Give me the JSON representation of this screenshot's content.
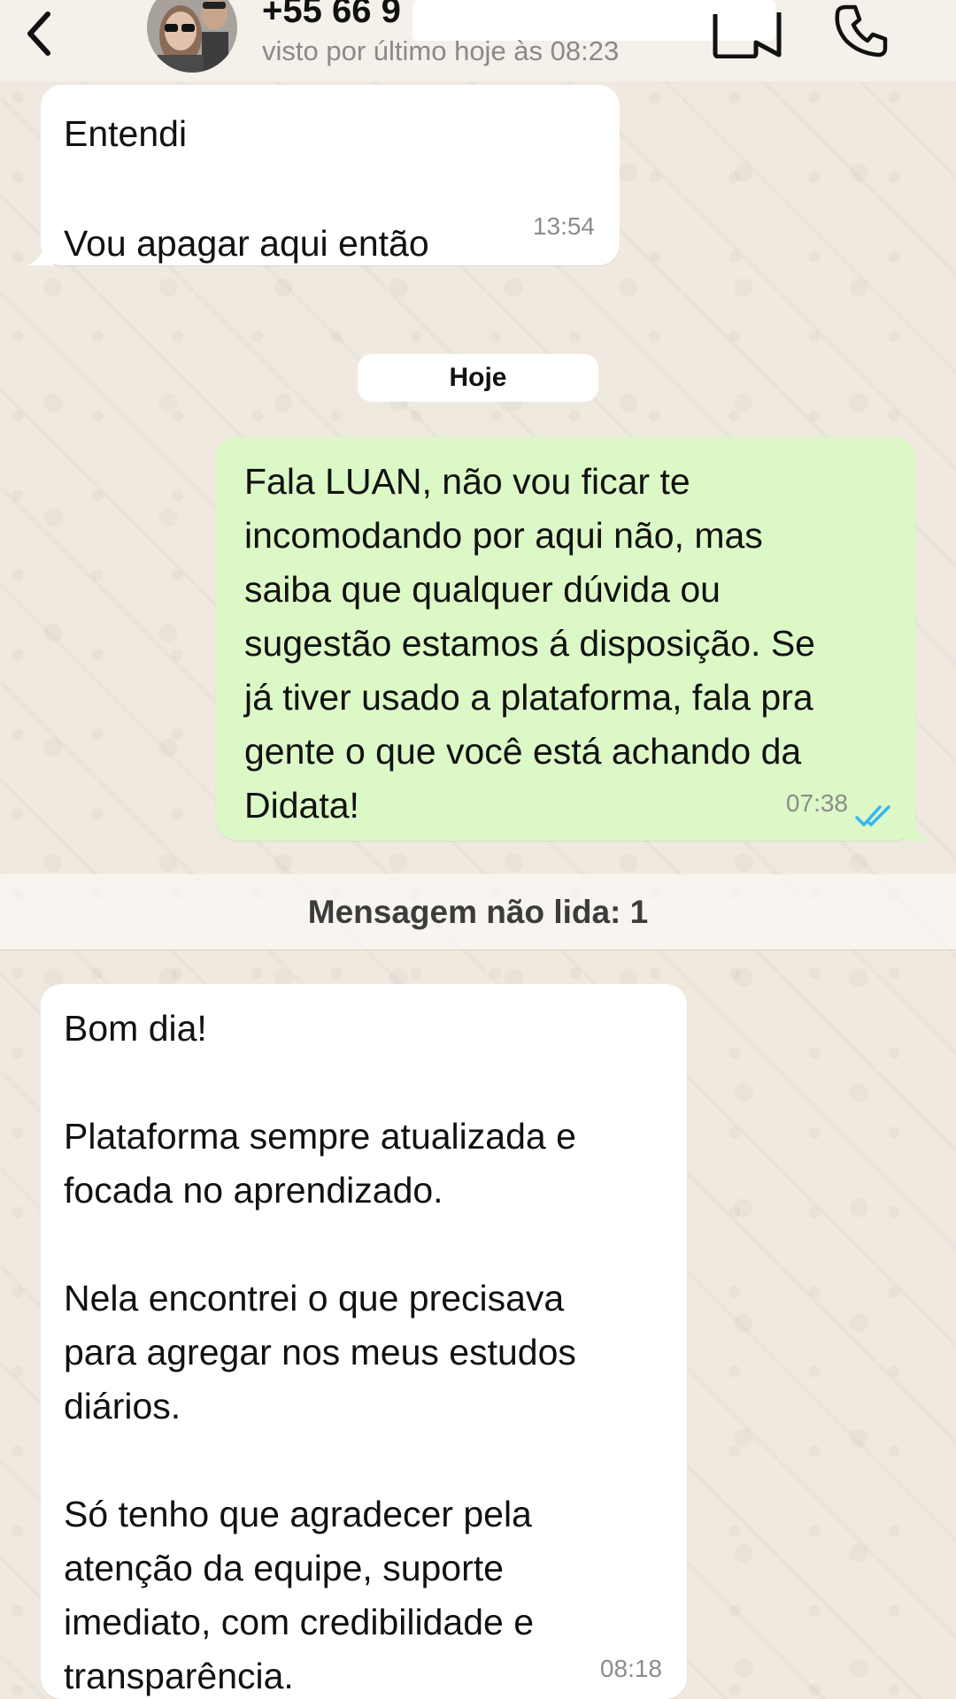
{
  "header": {
    "contact_name": "+55 66 9",
    "last_seen": "visto por último hoje às 08:23",
    "icons": {
      "back": "chevron-left-icon",
      "video": "video-camera-icon",
      "call": "phone-icon"
    }
  },
  "messages": [
    {
      "direction": "in",
      "text": "Entendi\n\nVou apagar aqui então",
      "time": "13:54"
    },
    {
      "direction": "out",
      "text": "Fala LUAN, não vou ficar te\nincomodando por aqui não, mas\nsaiba que qualquer dúvida ou\nsugestão estamos á disposição. Se\njá tiver usado a plataforma, fala pra\ngente o que você está achando da\nDidata!",
      "time": "07:38",
      "status": "read"
    },
    {
      "direction": "in",
      "text": "Bom dia!\n\nPlataforma sempre atualizada e\nfocada no aprendizado.\n\nNela encontrei o que precisava\npara agregar nos meus estudos\ndiários.\n\nSó tenho que agradecer pela\natenção da equipe, suporte\nimediato, com credibilidade e\ntransparência.",
      "time": "08:18"
    }
  ],
  "day_separator": "Hoje",
  "unread_banner": "Mensagem não lida: 1",
  "colors": {
    "incoming_bubble": "#ffffff",
    "outgoing_bubble": "#dcf8c6",
    "read_ticks": "#34b7f1",
    "wallpaper": "#efe9e0"
  }
}
